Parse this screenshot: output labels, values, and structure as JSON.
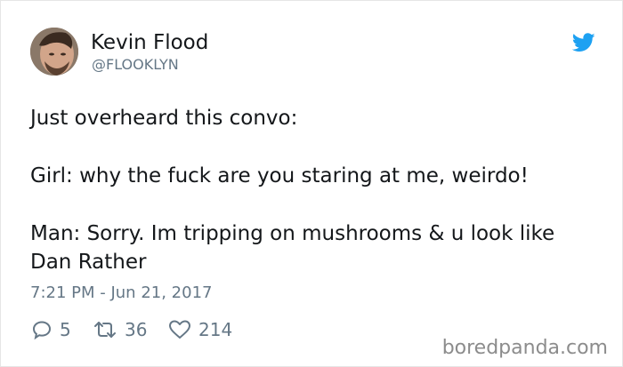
{
  "author": {
    "name": "Kevin Flood",
    "handle": "@FLOOKLYN"
  },
  "tweet": {
    "lines": [
      "Just overheard this convo:",
      "Girl: why the fuck are you staring at me, weirdo!",
      "Man: Sorry. Im tripping on mushrooms & u look like Dan Rather"
    ],
    "timestamp": "7:21 PM - Jun 21, 2017"
  },
  "actions": {
    "replies": "5",
    "retweets": "36",
    "likes": "214"
  },
  "icons": {
    "reply": "reply-icon",
    "retweet": "retweet-icon",
    "like": "heart-icon",
    "brand": "twitter-bird-icon"
  },
  "colors": {
    "text": "#14171a",
    "muted": "#657786",
    "twitter_blue": "#1da1f2",
    "watermark": "#8c8c8c"
  },
  "watermark": "boredpanda.com"
}
